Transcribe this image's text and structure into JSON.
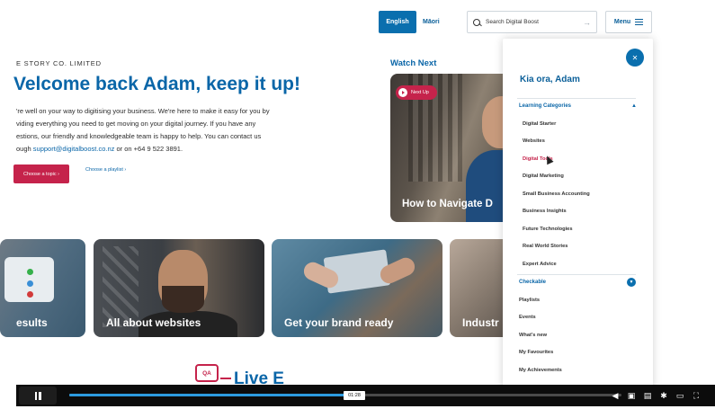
{
  "header": {
    "lang_english": "English",
    "lang_maori": "Māori",
    "search_placeholder": "Search Digital Boost",
    "menu_label": "Menu"
  },
  "welcome": {
    "org_name": "E STORY CO. LIMITED",
    "title": "Velcome back Adam, keep it up!",
    "intro_lines": [
      "'re well on your way to digitising your business. We're here to make it easy for you by",
      "viding everything you need to get moving on your digital journey. If you have any",
      "estions, our friendly and knowledgeable team is happy to help. You can contact us"
    ],
    "intro_last_prefix": "ough ",
    "support_email": "support@digitalboost.co.nz",
    "intro_last_suffix": " or on +64 9 522 3891.",
    "choose_topic": "Choose a topic ›",
    "choose_playlist": "Choose a playlist ›"
  },
  "watch_next": {
    "heading": "Watch Next",
    "badge": "Next Up",
    "video_title": "How to Navigate D"
  },
  "cards": [
    {
      "label": "esults"
    },
    {
      "label": "All about websites"
    },
    {
      "label": "Get your brand ready"
    },
    {
      "label": "Industr"
    }
  ],
  "live_events": {
    "icon_text": "QA",
    "title": "Live E"
  },
  "menu_panel": {
    "greeting": "Kia ora, Adam",
    "learning_categories": "Learning Categories",
    "categories": [
      "Digital Starter",
      "Websites",
      "Digital Tools",
      "Digital Marketing",
      "Small Business Accounting",
      "Business Insights",
      "Future Technologies",
      "Real World Stories",
      "Expert Advice"
    ],
    "active_category": "Digital Tools",
    "checkable": "Checkable",
    "items": [
      "Playlists",
      "Events",
      "What's new",
      "My Favourites",
      "My Achievements"
    ]
  },
  "player": {
    "current_time": "01:28",
    "progress_fraction": 0.515,
    "buffered_fraction": 0.53
  },
  "icons": [
    "search-icon",
    "arrow-right-icon",
    "hamburger-icon",
    "close-icon",
    "play-icon",
    "pause-icon",
    "volume-icon",
    "captions-icon",
    "settings-icon",
    "airplay-icon",
    "fullscreen-icon"
  ],
  "colors": {
    "primary_blue": "#0a6fae",
    "accent_red": "#c5234b",
    "player_progress": "#2c9be0"
  }
}
